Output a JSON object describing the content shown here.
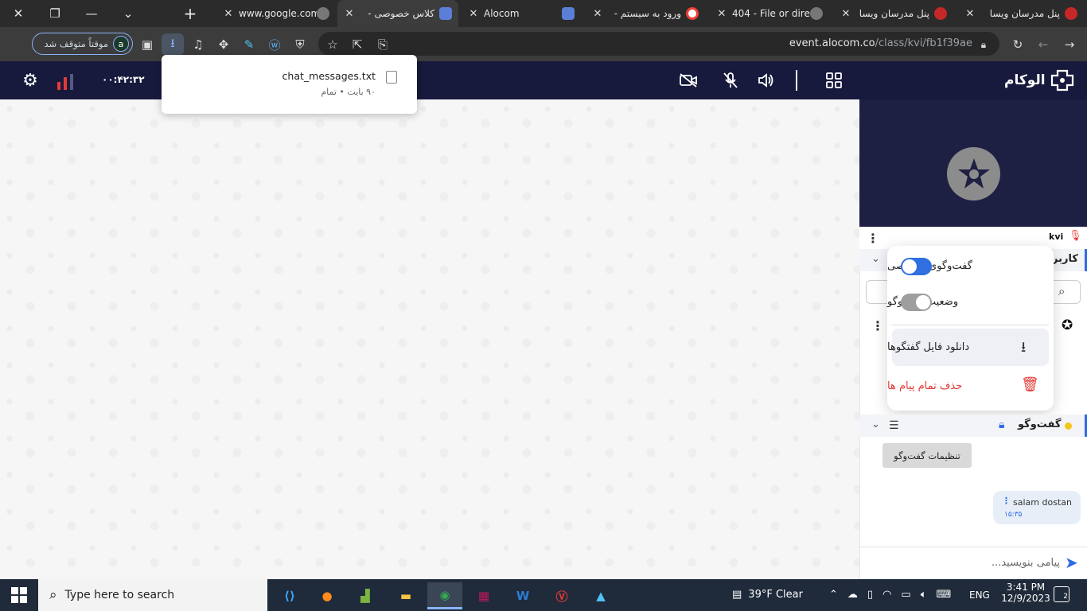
{
  "browser": {
    "tabs": [
      {
        "title": "www.google.com",
        "active": false
      },
      {
        "title": "کلاس خصوصی -",
        "active": true
      },
      {
        "title": "Alocom",
        "active": false
      },
      {
        "title": "ورود به سیستم -",
        "active": false
      },
      {
        "title": "404 - File or dire",
        "active": false
      },
      {
        "title": "پنل مدرسان ویسا",
        "active": false
      },
      {
        "title": "پنل مدرسان ویسا",
        "active": false
      }
    ],
    "new_tab": "+",
    "url_host": "event.alocom.co",
    "url_path": "/class/kvi/fb1f39ae",
    "profile_status": "موقتاً متوقف شد",
    "profile_initial": "a"
  },
  "download": {
    "filename": "chat_messages.txt",
    "status": "۹۰ بایت • تمام"
  },
  "app": {
    "brand": "الوکام",
    "timer": "۰۰:۴۲:۳۲"
  },
  "panel": {
    "user_name": "kvi",
    "users_section_label": "کاربر",
    "chat_section_label": "گفت‌وگو",
    "chat_settings_tooltip": "تنظیمات گفت‌وگو",
    "menu": {
      "private_chat": "گفت‌وگوی خصوصی",
      "chat_status": "وضعیت گفت‌وگو",
      "download_chats": "دانلود فایل گفتگوها",
      "delete_all": "حذف تمام پیام ها"
    },
    "message": {
      "text": "salam dostan",
      "time": "۱۵:۳۵"
    },
    "composer_placeholder": "پیامی بنویسید..."
  },
  "taskbar": {
    "search_placeholder": "Type here to search",
    "weather": "39°F  Clear",
    "language": "ENG",
    "time": "3:41 PM",
    "date": "12/9/2023",
    "notifications": "2"
  },
  "colors": {
    "accent": "#2d6be4",
    "header_bg": "#171a3d",
    "danger": "#e53935",
    "toggle_on": "#2f6fe0",
    "toggle_off": "#9e9e9e"
  }
}
